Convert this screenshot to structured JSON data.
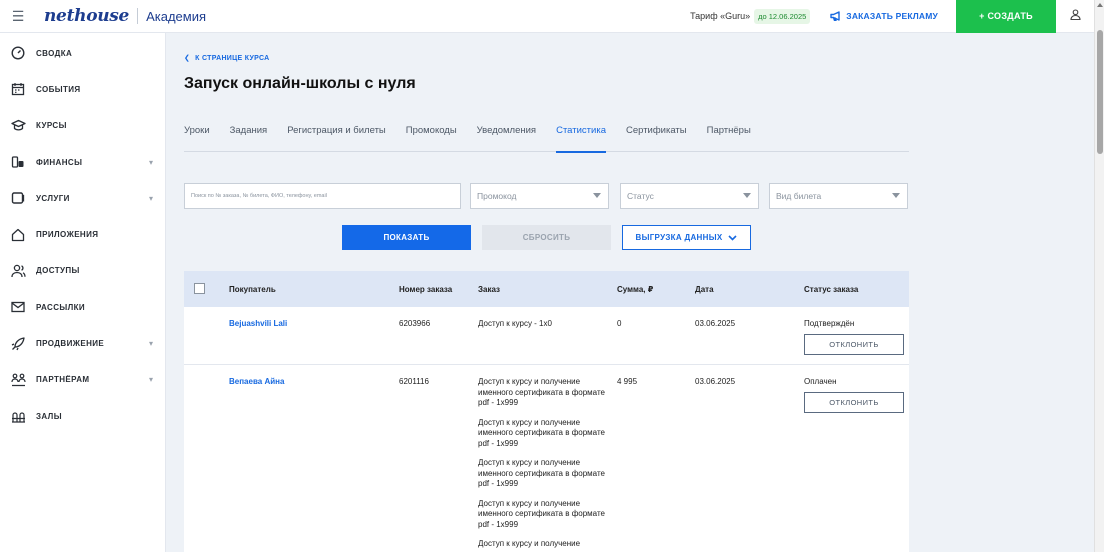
{
  "topbar": {
    "logo": "nethouse",
    "subtitle": "Академия",
    "tariff_label": "Тариф «Guru»",
    "tariff_until": "до 12.06.2025",
    "ad_button": "ЗАКАЗАТЬ РЕКЛАМУ",
    "create_button": "+ СОЗДАТЬ"
  },
  "sidebar": {
    "items": [
      {
        "label": "СВОДКА",
        "icon": "gauge-icon",
        "chevron": false
      },
      {
        "label": "СОБЫТИЯ",
        "icon": "calendar-icon",
        "chevron": false
      },
      {
        "label": "КУРСЫ",
        "icon": "graduation-cap-icon",
        "chevron": false
      },
      {
        "label": "ФИНАНСЫ",
        "icon": "coins-icon",
        "chevron": true
      },
      {
        "label": "УСЛУГИ",
        "icon": "services-icon",
        "chevron": true
      },
      {
        "label": "ПРИЛОЖЕНИЯ",
        "icon": "apps-icon",
        "chevron": false
      },
      {
        "label": "ДОСТУПЫ",
        "icon": "users-icon",
        "chevron": false
      },
      {
        "label": "РАССЫЛКИ",
        "icon": "mail-icon",
        "chevron": false
      },
      {
        "label": "ПРОДВИЖЕНИЕ",
        "icon": "rocket-icon",
        "chevron": true
      },
      {
        "label": "ПАРТНЁРАМ",
        "icon": "partners-icon",
        "chevron": true
      },
      {
        "label": "ЗАЛЫ",
        "icon": "hall-icon",
        "chevron": false
      }
    ]
  },
  "main": {
    "back_link": "К СТРАНИЦЕ КУРСА",
    "title": "Запуск онлайн-школы с нуля",
    "tabs": [
      {
        "label": "Уроки",
        "active": false
      },
      {
        "label": "Задания",
        "active": false
      },
      {
        "label": "Регистрация и билеты",
        "active": false
      },
      {
        "label": "Промокоды",
        "active": false
      },
      {
        "label": "Уведомления",
        "active": false
      },
      {
        "label": "Статистика",
        "active": true
      },
      {
        "label": "Сертификаты",
        "active": false
      },
      {
        "label": "Партнёры",
        "active": false
      }
    ],
    "filters": {
      "search_placeholder": "Поиск по № заказа, № билета, ФИО, телефону, email",
      "promo": "Промокод",
      "status": "Статус",
      "ticket_type": "Вид билета"
    },
    "buttons": {
      "show": "ПОКАЗАТЬ",
      "reset": "СБРОСИТЬ",
      "export": "ВЫГРУЗКА ДАННЫХ"
    },
    "table": {
      "headers": [
        "Покупатель",
        "Номер заказа",
        "Заказ",
        "Сумма, ₽",
        "Дата",
        "Статус заказа"
      ],
      "decline_label": "ОТКЛОНИТЬ",
      "rows": [
        {
          "buyer": "Bejuashvili Lali",
          "order_no": "6203966",
          "orders": [
            "Доступ к курсу - 1х0"
          ],
          "sum": "0",
          "date": "03.06.2025",
          "status": "Подтверждён"
        },
        {
          "buyer": "Вепаева Айна",
          "order_no": "6201116",
          "orders": [
            "Доступ к курсу и получение именного сертификата в формате pdf - 1х999",
            "Доступ к курсу и получение именного сертификата в формате pdf - 1х999",
            "Доступ к курсу и получение именного сертификата в формате pdf - 1х999",
            "Доступ к курсу и получение именного сертификата в формате pdf - 1х999",
            "Доступ к курсу и получение"
          ],
          "sum": "4 995",
          "date": "03.06.2025",
          "status": "Оплачен"
        }
      ]
    }
  }
}
